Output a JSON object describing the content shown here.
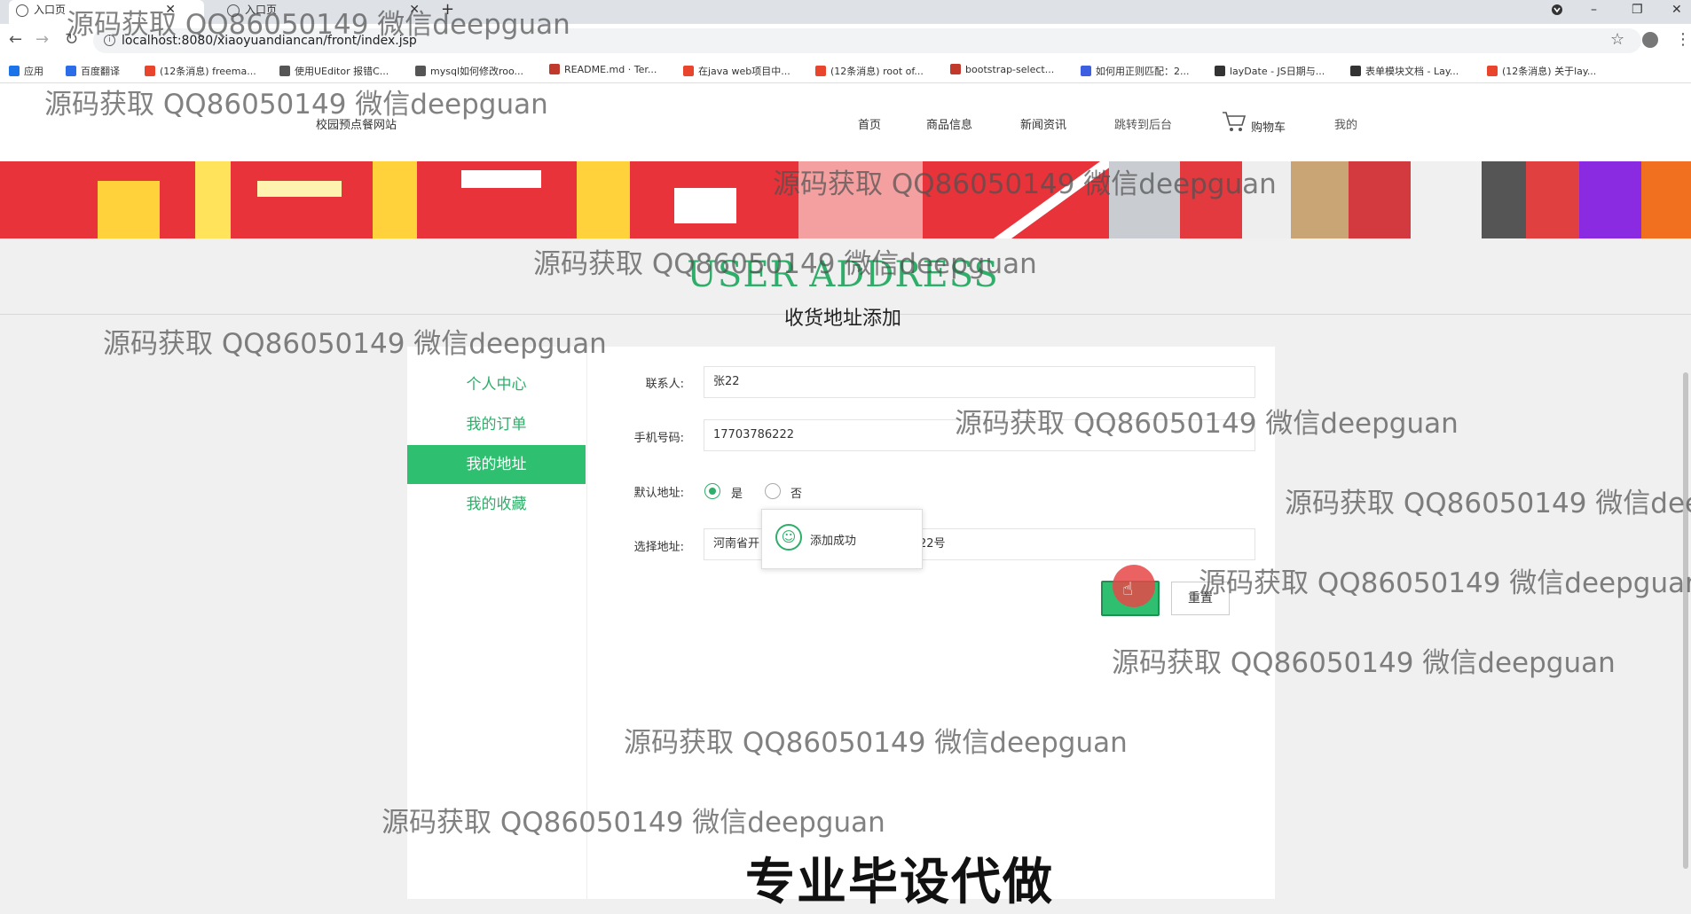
{
  "browser": {
    "tabs": [
      {
        "title": "入口页",
        "active": true
      },
      {
        "title": "入口页",
        "active": false
      }
    ],
    "new_tab": "+",
    "url": "localhost:8080/xiaoyuandiancan/front/index.jsp",
    "bookmarks": [
      {
        "label": "应用",
        "color": "#1a73e8"
      },
      {
        "label": "百度翻译",
        "color": "#2b6de8"
      },
      {
        "label": "(12条消息) freema...",
        "color": "#e8452c"
      },
      {
        "label": "使用UEditor 报错C...",
        "color": "#555555"
      },
      {
        "label": "mysql如何修改roo...",
        "color": "#555555"
      },
      {
        "label": "README.md · Ter...",
        "color": "#c0392b"
      },
      {
        "label": "在java web项目中...",
        "color": "#e8452c"
      },
      {
        "label": "(12条消息) root of...",
        "color": "#e8452c"
      },
      {
        "label": "bootstrap-select...",
        "color": "#c0392b"
      },
      {
        "label": "如何用正则匹配：2...",
        "color": "#3b5fe0"
      },
      {
        "label": "layDate - JS日期与...",
        "color": "#333333"
      },
      {
        "label": "表单模块文档 - Lay...",
        "color": "#333333"
      },
      {
        "label": "(12条消息) 关于lay...",
        "color": "#e8452c"
      }
    ]
  },
  "site": {
    "brand": "校园预点餐网站",
    "nav": [
      "首页",
      "商品信息",
      "新闻资讯",
      "跳转到后台",
      "购物车",
      "我的"
    ]
  },
  "page": {
    "title_en": "USER ADDRESS",
    "title_cn": "收货地址添加"
  },
  "sidebar": {
    "items": [
      {
        "label": "个人中心",
        "active": false
      },
      {
        "label": "我的订单",
        "active": false
      },
      {
        "label": "我的地址",
        "active": true
      },
      {
        "label": "我的收藏",
        "active": false
      }
    ]
  },
  "form": {
    "contact_label": "联系人:",
    "contact_value": "张22",
    "phone_label": "手机号码:",
    "phone_value": "17703786222",
    "default_label": "默认地址:",
    "default_yes": "是",
    "default_no": "否",
    "default_selected": "是",
    "address_label": "选择地址:",
    "address_value_left": "河南省开",
    "address_value_right": "22号",
    "reset_label": "重置"
  },
  "toast": {
    "message": "添加成功"
  },
  "overlay": {
    "watermark": "源码获取 QQ86050149 微信deepguan",
    "promo": "专业毕设代做"
  },
  "colors": {
    "accent": "#2fae6a",
    "active_bg": "#2fbf71"
  }
}
